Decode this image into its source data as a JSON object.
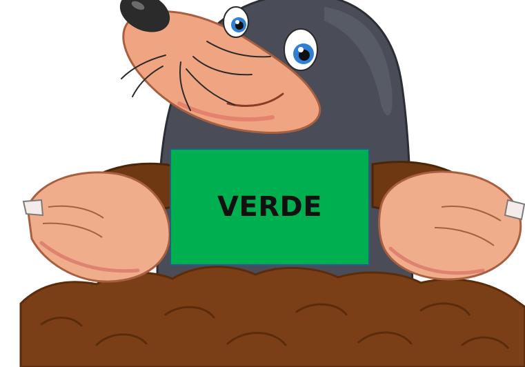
{
  "card": {
    "word": "VERDE",
    "background_color": "#00b050",
    "text_color": "#111111",
    "border_color": "#2a5a8a"
  },
  "mole": {
    "fur_color": "#4a4d57",
    "snout_color": "#f0a582",
    "paw_color": "#efad8c",
    "nose_color": "#2b2b2b",
    "eye_iris_color": "#2f7fd6"
  },
  "dirt": {
    "color": "#7a3f16",
    "outline_color": "#5a2c0c"
  }
}
